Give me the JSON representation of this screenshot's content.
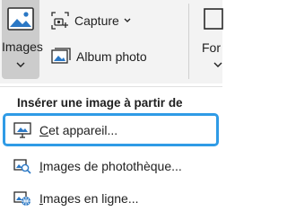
{
  "ribbon": {
    "images_label": "Images",
    "capture_label": "Capture",
    "album_label": "Album photo",
    "forms_label_partial": "For"
  },
  "menu": {
    "header": "Insérer une image à partir de",
    "items": [
      {
        "prefix": "",
        "mnemonic": "C",
        "rest": "et appareil...",
        "icon": "device-icon"
      },
      {
        "prefix": "",
        "mnemonic": "I",
        "rest": "mages de photothèque...",
        "icon": "stock-images-icon"
      },
      {
        "prefix": "",
        "mnemonic": "I",
        "rest": "mages en ligne...",
        "icon": "online-images-icon"
      }
    ]
  },
  "colors": {
    "focus_ring": "#2f9be6",
    "icon_blue": "#2b78c5",
    "ribbon_bg": "#f3f3f3",
    "pressed_bg": "#cccccc"
  }
}
